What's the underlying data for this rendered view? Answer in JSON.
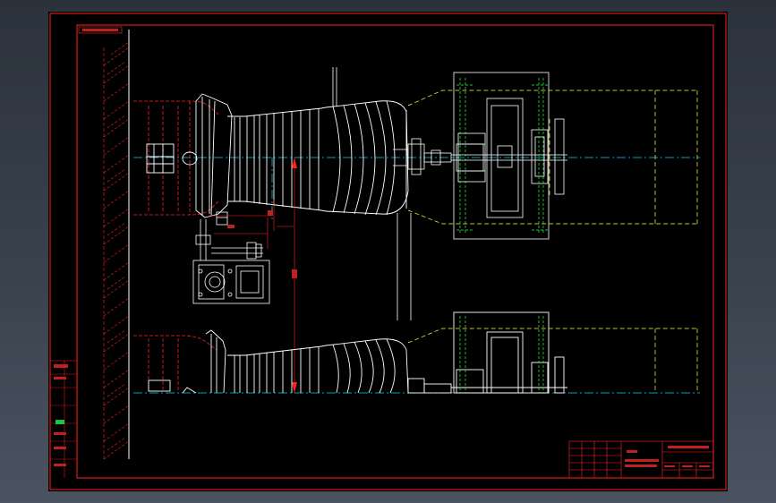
{
  "viewer": {
    "background_top": "#2b323c",
    "background_bottom": "#4a5360",
    "sheet_color": "#000000"
  },
  "drawing": {
    "colors": {
      "frame": "#ff2020",
      "outline": "#ffffff",
      "centerline": "#00d8ff",
      "hidden": "#ff2020",
      "phantom": "#ffff40",
      "extension": "#20ff40",
      "hatch": "#ff2020"
    }
  }
}
